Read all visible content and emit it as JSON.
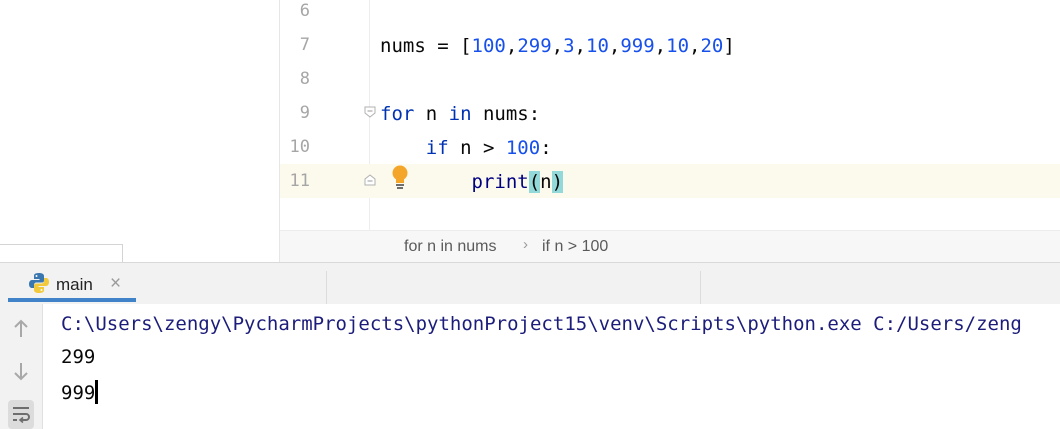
{
  "editor": {
    "lines": [
      {
        "number": "6"
      },
      {
        "number": "7",
        "tokens": {
          "var": "nums",
          "eq": " = [",
          "n1": "100",
          "n2": "299",
          "n3": "3",
          "n4": "10",
          "n5": "999",
          "n6": "10",
          "n7": "20",
          "close": "]"
        }
      },
      {
        "number": "8"
      },
      {
        "number": "9",
        "tokens": {
          "kw_for": "for",
          "var": " n ",
          "kw_in": "in",
          "rest": " nums:"
        }
      },
      {
        "number": "10",
        "tokens": {
          "indent": "    ",
          "kw_if": "if",
          "mid": " n > ",
          "num": "100",
          "colon": ":"
        }
      },
      {
        "number": "11",
        "tokens": {
          "indent": "        ",
          "fn": "print",
          "lp": "(",
          "arg": "n",
          "rp": ")"
        }
      }
    ],
    "breadcrumbs": [
      "for n in nums",
      "if n > 100"
    ]
  },
  "run_panel": {
    "tab": {
      "label": "main",
      "close": "×"
    },
    "console": {
      "command": "C:\\Users\\zengy\\PycharmProjects\\pythonProject15\\venv\\Scripts\\python.exe C:/Users/zeng",
      "output": [
        "299",
        "999"
      ]
    },
    "toolbar": [
      "up-arrow-icon",
      "down-arrow-icon",
      "soft-wrap-icon"
    ]
  },
  "colors": {
    "keyword": "#0033b3",
    "number": "#1750eb",
    "current_line": "#fcfaed",
    "brace_match": "#93d9d9",
    "tab_accent": "#4083c9"
  }
}
